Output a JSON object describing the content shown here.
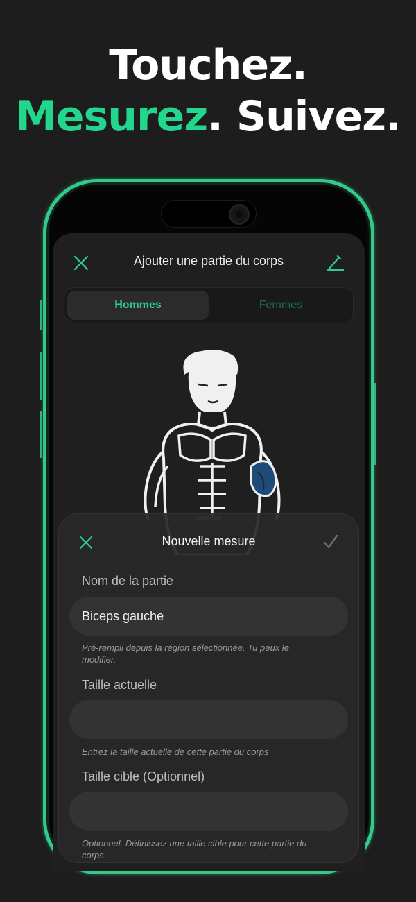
{
  "headline": {
    "line1": "Touchez.",
    "line2_accent": "Mesurez",
    "line2_rest": ". Suivez."
  },
  "colors": {
    "accent": "#22d68e",
    "phone_frame": "#34c98a",
    "selected_region": "#1e4b78"
  },
  "back_sheet": {
    "title": "Ajouter une partie du corps",
    "close_icon": "close-icon",
    "edit_icon": "edit-icon",
    "segments": [
      {
        "label": "Hommes",
        "selected": true
      },
      {
        "label": "Femmes",
        "selected": false
      }
    ],
    "selected_region": "Biceps gauche"
  },
  "front_sheet": {
    "title": "Nouvelle mesure",
    "close_icon": "close-icon",
    "confirm_icon": "checkmark-icon",
    "fields": [
      {
        "label": "Nom de la partie",
        "value": "Biceps gauche",
        "help": "Pré-rempli depuis la région sélectionnée. Tu peux le modifier."
      },
      {
        "label": "Taille actuelle",
        "value": "",
        "help": "Entrez la taille actuelle de cette partie du corps"
      },
      {
        "label": "Taille cible (Optionnel)",
        "value": "",
        "help": "Optionnel. Définissez une taille cible pour cette partie du corps."
      }
    ]
  }
}
